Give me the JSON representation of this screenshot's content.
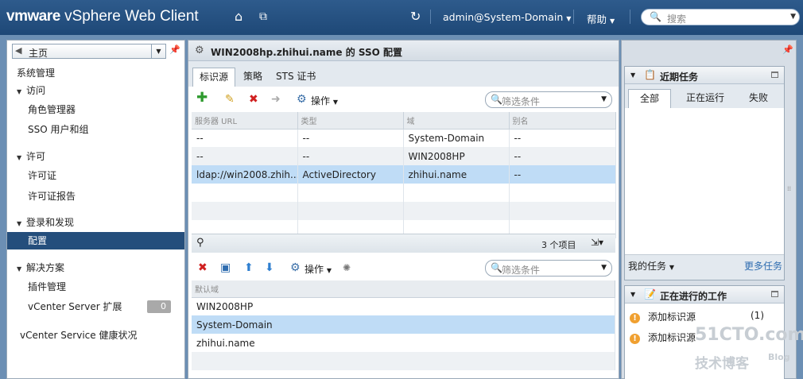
{
  "header": {
    "brand_vm": "vmware",
    "brand_product": "vSphere Web Client",
    "user": "admin@System-Domain",
    "help": "帮助",
    "search_placeholder": "搜索",
    "colors": {
      "bar": "#1e4877"
    }
  },
  "nav": {
    "home_label": "主页",
    "items": [
      {
        "label": "系统管理"
      },
      {
        "label": "访问"
      },
      {
        "label": "角色管理器"
      },
      {
        "label": "SSO 用户和组"
      },
      {
        "label": "许可"
      },
      {
        "label": "许可证"
      },
      {
        "label": "许可证报告"
      },
      {
        "label": "登录和发现"
      },
      {
        "label": "配置"
      },
      {
        "label": "解决方案"
      },
      {
        "label": "插件管理"
      },
      {
        "label": "vCenter Server 扩展",
        "badge": "0"
      },
      {
        "label": "vCenter Service 健康状况"
      }
    ]
  },
  "center": {
    "title": "WIN2008hp.zhihui.name 的 SSO 配置",
    "tabs": [
      "标识源",
      "策略",
      "STS 证书"
    ],
    "actions_label": "操作",
    "filter_placeholder": "筛选条件",
    "columns": [
      "服务器 URL",
      "类型",
      "域",
      "别名"
    ],
    "rows": [
      [
        "--",
        "--",
        "System-Domain",
        "--"
      ],
      [
        "--",
        "--",
        "WIN2008HP",
        "--"
      ],
      [
        "ldap://win2008.zhih...",
        "ActiveDirectory",
        "zhihui.name",
        "--"
      ]
    ],
    "item_count": "3 个项目",
    "lower": {
      "actions_label": "操作",
      "filter_placeholder": "筛选条件",
      "column": "默认域",
      "rows": [
        "WIN2008HP",
        "System-Domain",
        "zhihui.name"
      ]
    }
  },
  "right": {
    "recent_tasks": {
      "title": "近期任务",
      "tabs": [
        "全部",
        "正在运行",
        "失败"
      ],
      "my_tasks": "我的任务",
      "more_tasks": "更多任务"
    },
    "work_in_progress": {
      "title": "正在进行的工作",
      "items": [
        {
          "label": "添加标识源",
          "count": "(1)"
        },
        {
          "label": "添加标识源"
        }
      ]
    }
  },
  "watermark": {
    "site": "51CTO.com",
    "sub": "技术博客",
    "blog": "Blog"
  }
}
